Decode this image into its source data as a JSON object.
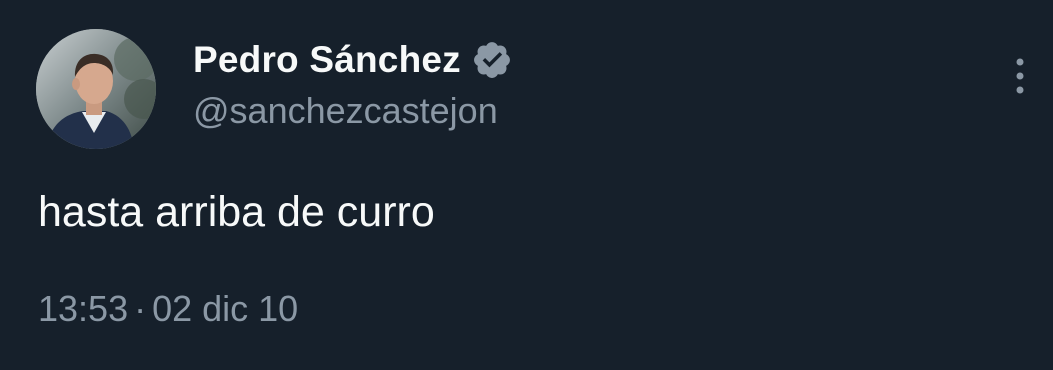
{
  "author": {
    "display_name": "Pedro Sánchez",
    "handle": "@sanchezcastejon",
    "verified_icon": "verified-badge-icon",
    "avatar": "profile-photo"
  },
  "tweet": {
    "text": "hasta arriba de curro",
    "time": "13:53",
    "separator": "·",
    "date": "02 dic 10"
  },
  "actions": {
    "more_icon": "more-vertical-icon"
  },
  "colors": {
    "background": "#16202b",
    "primary_text": "#f7f9f9",
    "secondary_text": "#8b98a5",
    "badge": "#8b98a5"
  }
}
